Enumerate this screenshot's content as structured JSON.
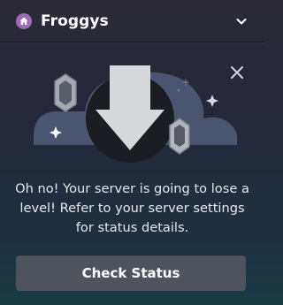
{
  "header": {
    "server_name": "Froggys",
    "server_icon": "house-icon",
    "dropdown_icon": "chevron-down-icon"
  },
  "alert": {
    "close_icon": "close-icon",
    "illustration": "down-arrow-with-gems-illustration",
    "message": "Oh no! Your server is going to lose a level! Refer to your server settings for status details.",
    "button_label": "Check Status"
  },
  "colors": {
    "server_badge": "#9b6ab8",
    "button": "#4f545c",
    "illustration_blob": "#4b5470",
    "arrow_circle": "#1c1d23",
    "arrow": "#d7d8dc"
  }
}
